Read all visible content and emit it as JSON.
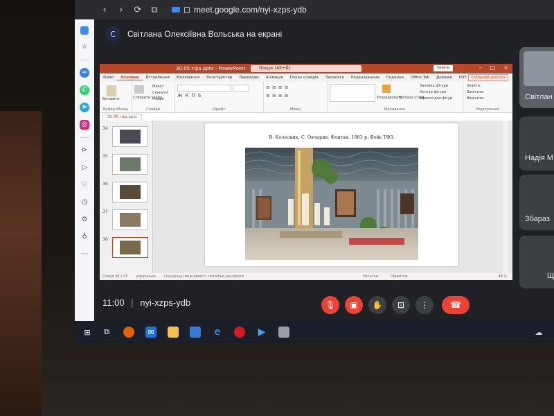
{
  "browser": {
    "url": "meet.google.com/nyi-xzps-ydb",
    "nav": [
      "‹",
      "›",
      "⟳",
      "⧉"
    ]
  },
  "meet": {
    "presenter_avatar": "C",
    "presenter_text": "Світлана Олексіївна Вольська на екрані",
    "time": "11:00",
    "separator": "|",
    "code": "nyi-xzps-ydb",
    "participants": [
      "Світлан",
      "Надія М",
      "Збараз",
      "Ще"
    ]
  },
  "ppt": {
    "filename": "30.05.тфа.pptx - PowerPoint",
    "search": "Пошук (Alt+Й)",
    "signin": "Увійти",
    "share": "Спільний доступ",
    "tabs": [
      "Файл",
      "Основне",
      "Вставлення",
      "Малювання",
      "Конструктор",
      "Переходи",
      "Анімація",
      "Показ слайдів",
      "Записати",
      "Рецензування",
      "Подання",
      "Office Tab",
      "Довідка",
      "PDF-XChange"
    ],
    "active_tab_index": 1,
    "ribbon_groups": [
      "Буфер обміну",
      "Слайди",
      "Шрифт",
      "Абзац",
      "Малювання",
      "Редагування"
    ],
    "ribbon_buttons": {
      "paste": "Вставити",
      "new_slide": "Створити слайд",
      "layout": "Макет",
      "reset": "Скинути",
      "section": "Розділ",
      "arrange": "Упорядкувати",
      "quick_styles": "Експрес-стилі",
      "shape_fill": "Заливка фігури",
      "shape_outline": "Контур фігури",
      "shape_effects": "Ефекти для фігур",
      "find": "Знайти",
      "replace": "Замінити",
      "select": "Виділити"
    },
    "doc_tab": "30.05.тфа.pptx",
    "thumbnails": [
      {
        "num": "34",
        "selected": false,
        "color": "#4a4a55"
      },
      {
        "num": "35",
        "selected": false,
        "color": "#6b7a6a"
      },
      {
        "num": "36",
        "selected": false,
        "color": "#5a4a3a"
      },
      {
        "num": "37",
        "selected": false,
        "color": "#8a7a60"
      },
      {
        "num": "38",
        "selected": true,
        "color": "#7a6a4a"
      }
    ],
    "slide_caption": "В. Колесник, С. Овчарик. Фонтан. 1983 р. Фойє ТФЗ.",
    "status_left": "Слайд 38 з 55",
    "status_lang": "українська",
    "status_access": "Спеціальні можливості: потрібно дослідити",
    "status_notes": "Нотатки",
    "status_comments": "Примітки",
    "zoom": "48 %"
  },
  "colors": {
    "ppt_accent": "#b7472a",
    "meet_red": "#ea4335",
    "meet_bg": "#202124"
  }
}
